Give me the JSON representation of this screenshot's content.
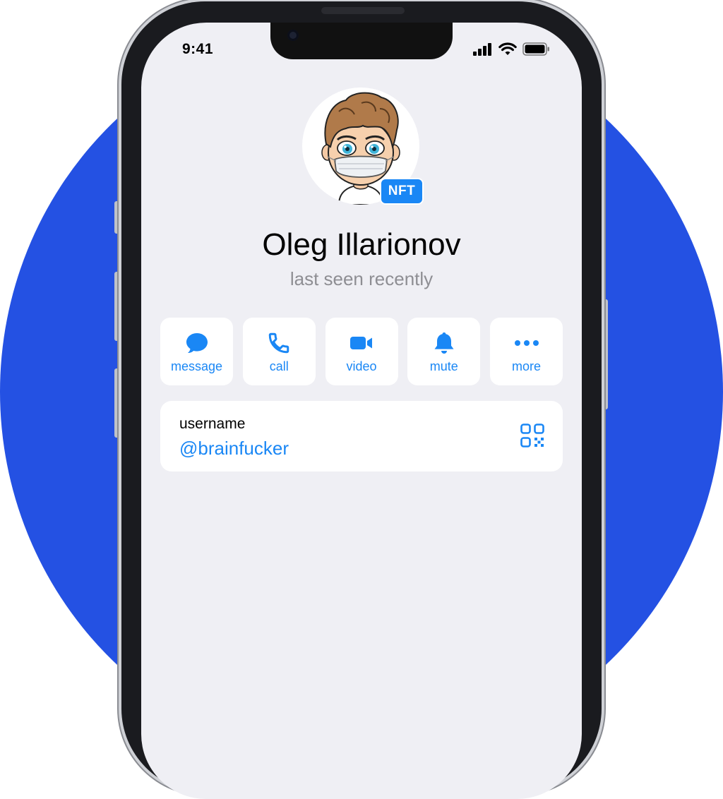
{
  "status_bar": {
    "time": "9:41"
  },
  "profile": {
    "badge": "NFT",
    "name": "Oleg Illarionov",
    "status": "last seen recently"
  },
  "actions": [
    {
      "label": "message",
      "icon": "message-bubble-icon"
    },
    {
      "label": "call",
      "icon": "phone-icon"
    },
    {
      "label": "video",
      "icon": "video-camera-icon"
    },
    {
      "label": "mute",
      "icon": "bell-icon"
    },
    {
      "label": "more",
      "icon": "ellipsis-icon"
    }
  ],
  "info": {
    "label": "username",
    "value": "@brainfucker",
    "icon": "qr-code-icon"
  },
  "colors": {
    "accent": "#1A87F5",
    "background_circle": "#2451E3",
    "screen_background": "#EFEFF4",
    "secondary_text": "#8E8E93"
  }
}
